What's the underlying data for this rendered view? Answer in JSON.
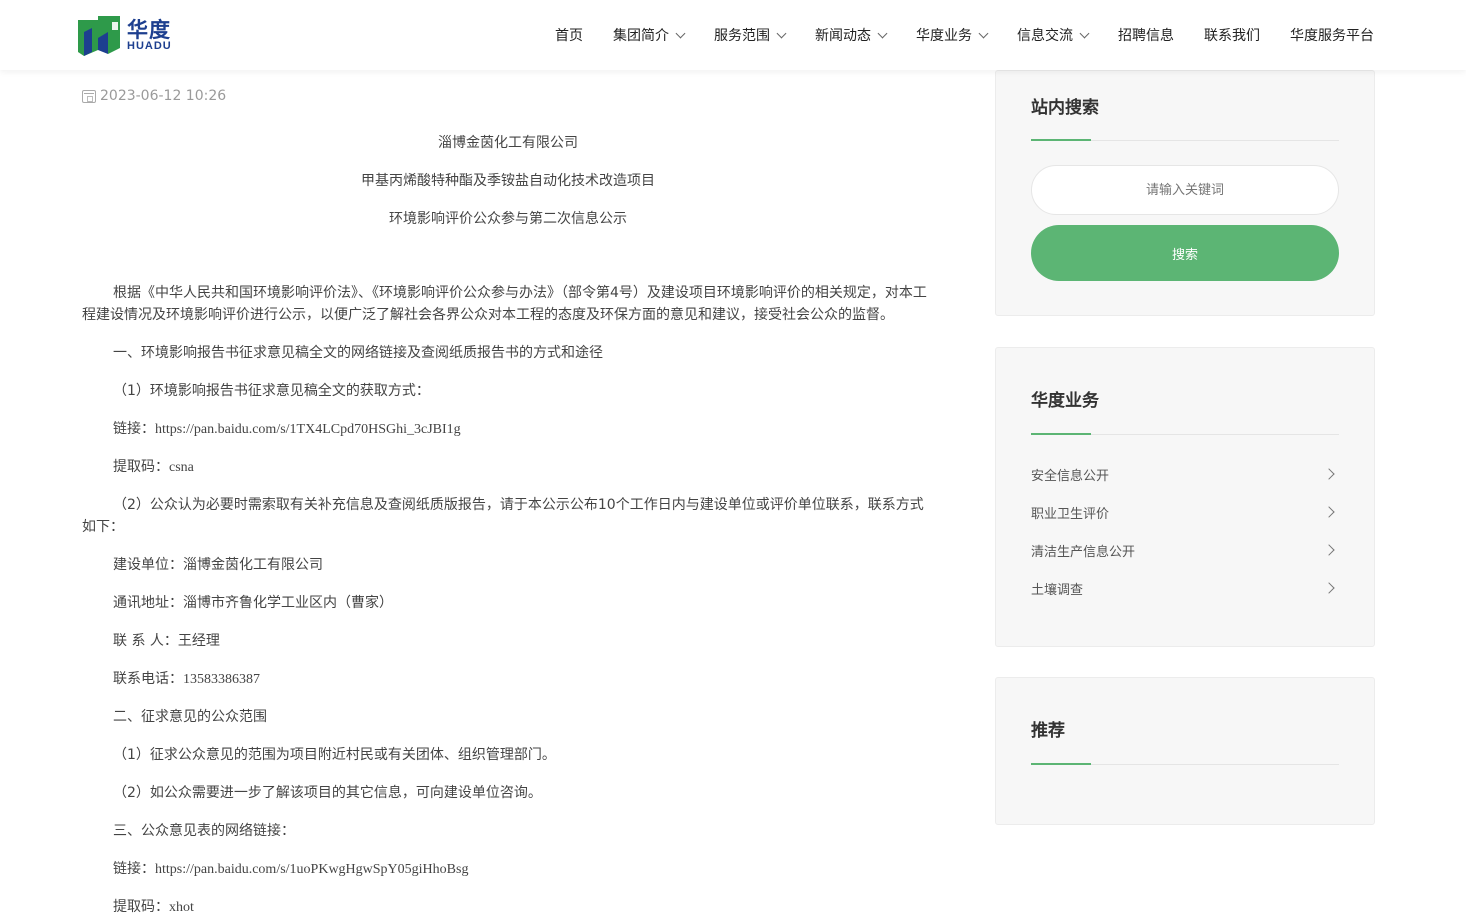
{
  "brand": {
    "name_cn": "华度",
    "name_en": "HUADU",
    "colors": {
      "primary_green": "#5cb574",
      "logo_blue": "#1d3f8f",
      "logo_green": "#2e9a4a"
    }
  },
  "nav": {
    "items": [
      {
        "label": "首页",
        "has_dropdown": false
      },
      {
        "label": "集团简介",
        "has_dropdown": true
      },
      {
        "label": "服务范围",
        "has_dropdown": true
      },
      {
        "label": "新闻动态",
        "has_dropdown": true
      },
      {
        "label": "华度业务",
        "has_dropdown": true
      },
      {
        "label": "信息交流",
        "has_dropdown": true
      },
      {
        "label": "招聘信息",
        "has_dropdown": false
      },
      {
        "label": "联系我们",
        "has_dropdown": false
      },
      {
        "label": "华度服务平台",
        "has_dropdown": false
      }
    ]
  },
  "article": {
    "date": "2023-06-12 10:26",
    "title_lines": [
      "淄博金茵化工有限公司",
      "甲基丙烯酸特种酯及季铵盐自动化技术改造项目",
      "环境影响评价公众参与第二次信息公示"
    ],
    "intro": "根据《中华人民共和国环境影响评价法》、《环境影响评价公众参与办法》（部令第4号）及建设项目环境影响评价的相关规定，对本工程建设情况及环境影响评价进行公示，以便广泛了解社会各界公众对本工程的态度及环保方面的意见和建议，接受社会公众的监督。",
    "section1_title": "一、环境影响报告书征求意见稿全文的网络链接及查阅纸质报告书的方式和途径",
    "section1_item1": "（1）环境影响报告书征求意见稿全文的获取方式：",
    "link1_label": "链接：",
    "link1": "https://pan.baidu.com/s/1TX4LCpd70HSGhi_3cJBI1g",
    "code1_label": "提取码：",
    "code1": "csna",
    "section1_item2": "（2）公众认为必要时需索取有关补充信息及查阅纸质版报告，请于本公示公布10个工作日内与建设单位或评价单位联系，联系方式如下：",
    "builder": "建设单位：淄博金茵化工有限公司",
    "address": "通讯地址：淄博市齐鲁化学工业区内（曹家）",
    "contact": "联 系 人：王经理",
    "phone_label": "联系电话：",
    "phone": "13583386387",
    "section2_title": "二、征求意见的公众范围",
    "section2_item1": "（1）征求公众意见的范围为项目附近村民或有关团体、组织管理部门。",
    "section2_item2": "（2）如公众需要进一步了解该项目的其它信息，可向建设单位咨询。",
    "section3_title": "三、公众意见表的网络链接：",
    "link2_label": "链接：",
    "link2": "https://pan.baidu.com/s/1uoPKwgHgwSpY05giHhoBsg",
    "code2_label": "提取码：",
    "code2": "xhot"
  },
  "sidebar": {
    "search": {
      "title": "站内搜索",
      "placeholder": "请输入关键词",
      "button": "搜索"
    },
    "business": {
      "title": "华度业务",
      "items": [
        "安全信息公开",
        "职业卫生评价",
        "清洁生产信息公开",
        "土壤调查"
      ]
    },
    "recommend": {
      "title": "推荐"
    }
  }
}
